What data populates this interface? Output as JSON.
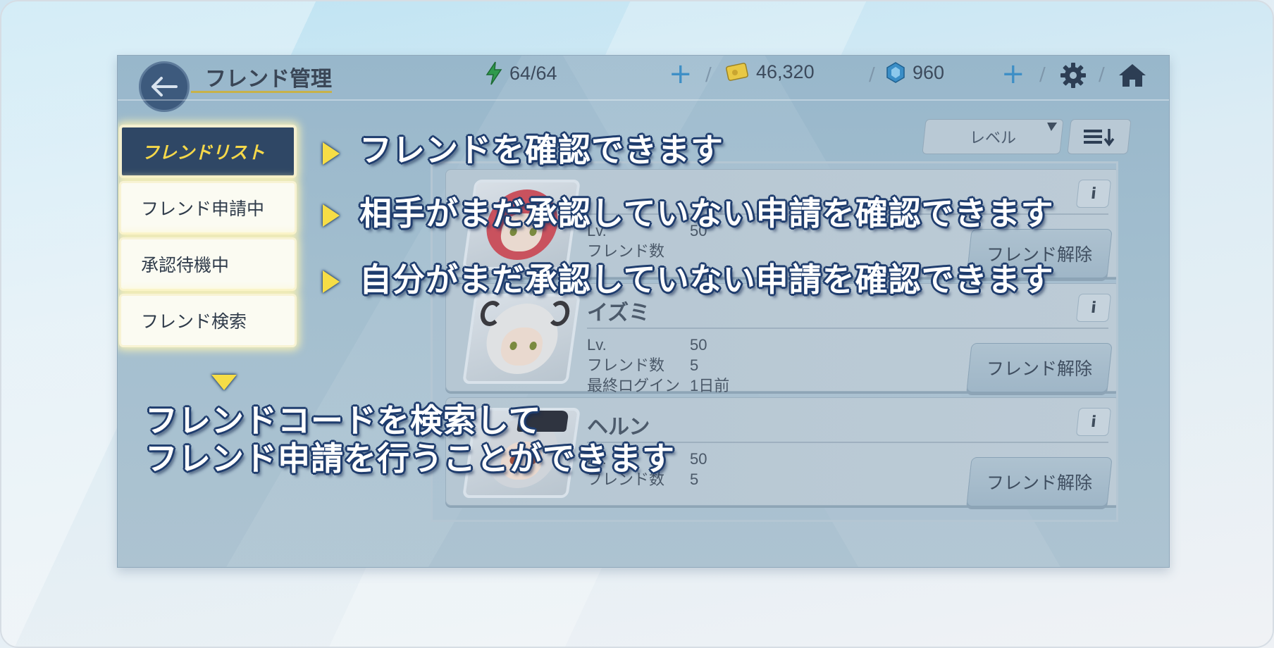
{
  "header": {
    "title": "フレンド管理",
    "stamina": "64/64",
    "gold": "46,320",
    "gems": "960",
    "plus_symbol": "+",
    "separator": "/"
  },
  "sort": {
    "selected": "レベル"
  },
  "tabs": [
    {
      "label": "フレンドリスト",
      "active": true
    },
    {
      "label": "フレンド申請中",
      "active": false
    },
    {
      "label": "承認待機中",
      "active": false
    },
    {
      "label": "フレンド検索",
      "active": false
    }
  ],
  "callouts": {
    "friend_list": "フレンドを確認できます",
    "pending_sent": "相手がまだ承認していない申請を確認できます",
    "pending_received": "自分がまだ承認していない申請を確認できます",
    "search_line1": "フレンドコードを検索して",
    "search_line2": "フレンド申請を行うことができます"
  },
  "friends": [
    {
      "name": "",
      "level_label": "Lv.",
      "level": "50",
      "friends_label": "フレンド数",
      "friends_count": "",
      "login_label": "",
      "login": "",
      "info_label": "i",
      "unfriend_label": "フレンド解除"
    },
    {
      "name": "イズミ",
      "level_label": "Lv.",
      "level": "50",
      "friends_label": "フレンド数",
      "friends_count": "5",
      "login_label": "最終ログイン",
      "login": "1日前",
      "info_label": "i",
      "unfriend_label": "フレンド解除"
    },
    {
      "name": "ヘルン",
      "level_label": "Lv.",
      "level": "50",
      "friends_label": "フレンド数",
      "friends_count": "5",
      "info_label": "i",
      "unfriend_label": "フレンド解除"
    }
  ],
  "colors": {
    "accent_yellow": "#f6dd46",
    "callout_outline": "#1f3d6e",
    "active_tab": "#2f4765"
  },
  "icons": [
    "back-arrow-icon",
    "lightning-icon",
    "gold-card-icon",
    "gem-icon",
    "gear-icon",
    "home-icon",
    "sort-order-icon"
  ]
}
